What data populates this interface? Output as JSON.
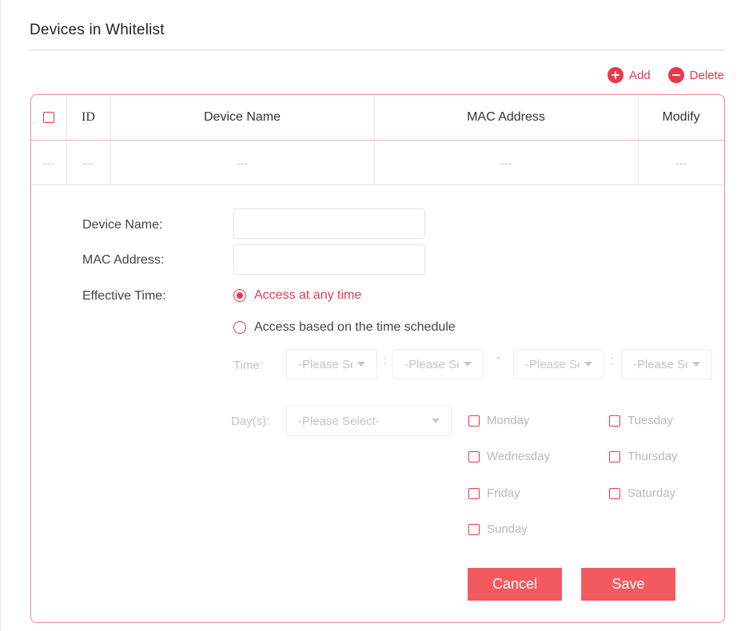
{
  "section": {
    "title": "Devices in Whitelist"
  },
  "toolbar": {
    "add_label": "Add",
    "delete_label": "Delete"
  },
  "table": {
    "columns": [
      "ID",
      "Device Name",
      "MAC Address",
      "Modify"
    ],
    "empty_row": [
      "---",
      "---",
      "---",
      "---",
      "---"
    ]
  },
  "form": {
    "device_name_label": "Device Name:",
    "device_name_value": "",
    "mac_address_label": "MAC Address:",
    "mac_address_value": "",
    "effective_time_label": "Effective Time:",
    "options": [
      {
        "label": "Access at any time",
        "selected": true
      },
      {
        "label": "Access based on the time schedule",
        "selected": false
      }
    ],
    "time_label": "Time:",
    "time_selects": [
      "-Please Select-",
      "-Please Select-",
      "-Please Select-",
      "-Please Select-"
    ],
    "time_colon": ":",
    "time_dash": "-",
    "days_label": "Day(s):",
    "days_select": "-Please Select-",
    "days": [
      "Monday",
      "Tuesday",
      "Wednesday",
      "Thursday",
      "Friday",
      "Saturday",
      "Sunday"
    ]
  },
  "buttons": {
    "cancel": "Cancel",
    "save": "Save"
  },
  "colors": {
    "accent": "#e8394c",
    "button": "#f25a5f"
  }
}
